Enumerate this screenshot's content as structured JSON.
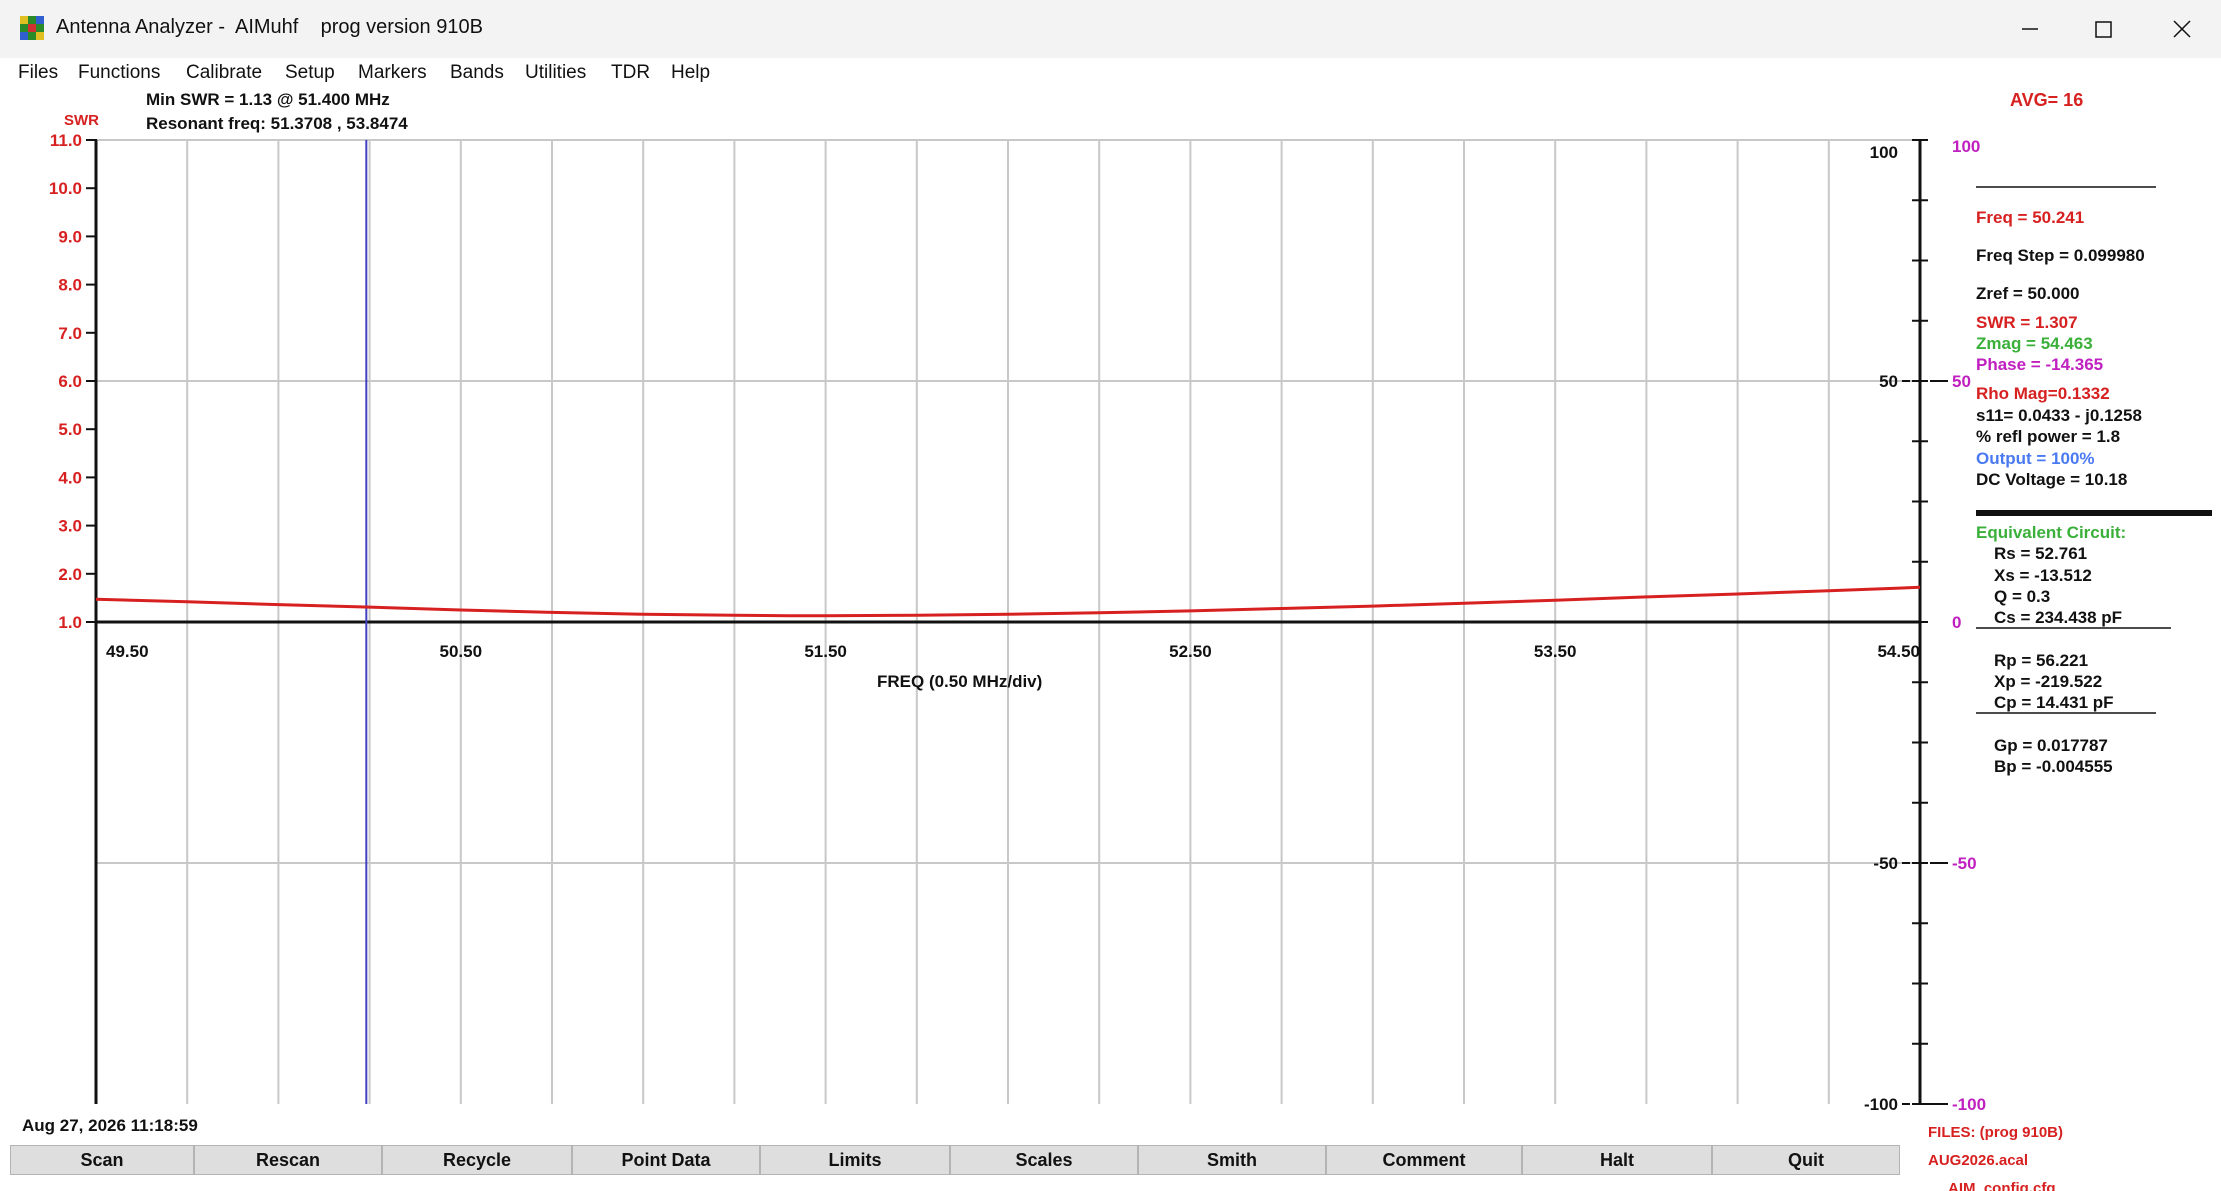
{
  "window": {
    "title": "Antenna Analyzer -  AIMuhf    prog version 910B",
    "icon": "aim-app-icon"
  },
  "menu": [
    "Files",
    "Functions",
    "Calibrate",
    "Setup",
    "Markers",
    "Bands",
    "Utilities",
    "TDR",
    "Help"
  ],
  "header": {
    "min_swr": "Min SWR =   1.13 @  51.400 MHz",
    "resonant": "Resonant freq:  51.3708 , 53.8474",
    "avg": "AVG=  16",
    "swr_axis_label": "SWR"
  },
  "readout": {
    "freq": "Freq = 50.241",
    "freq_step": "Freq Step = 0.099980",
    "zref": "Zref =    50.000",
    "swr": "SWR =    1.307",
    "zmag": "Zmag =    54.463",
    "phase": "Phase =   -14.365",
    "rho_mag": "Rho Mag=0.1332",
    "s11": "s11= 0.0433 - j0.1258",
    "refl_power": "% refl power =   1.8",
    "output": "Output =  100%",
    "dc_voltage": "DC Voltage =  10.18",
    "equiv_title": "Equivalent Circuit:",
    "rs": "Rs =   52.761",
    "xs": "Xs =  -13.512",
    "q": "Q =   0.3",
    "cs": "Cs =  234.438  pF",
    "rp": "Rp =    56.221",
    "xp": "Xp = -219.522",
    "cp": "Cp =   14.431  pF",
    "gp": "Gp =  0.017787",
    "bp": "Bp = -0.004555"
  },
  "status": {
    "timestamp": "Aug 27, 2026  11:18:59",
    "files_label": "FILES:  (prog 910B)",
    "cal_file": "AUG2026.acal",
    "config_file": "AIM_config.cfg"
  },
  "buttons": [
    "Scan",
    "Rescan",
    "Recycle",
    "Point Data",
    "Limits",
    "Scales",
    "Smith",
    "Comment",
    "Halt",
    "Quit"
  ],
  "colors": {
    "swr": "#d72020",
    "zmag": "#3ab03a",
    "phase": "#c020c0",
    "output": "#4a7af2",
    "grid": "#c8c8c8",
    "cursor": "#4040c0"
  },
  "chart_data": {
    "type": "line",
    "xlabel": "FREQ (0.50 MHz/div)",
    "xlim": [
      49.5,
      54.5
    ],
    "x_ticks": [
      "49.50",
      "50.50",
      "51.50",
      "52.50",
      "53.50",
      "54.50"
    ],
    "y_left_label": "SWR",
    "y_left_ticks": [
      "11.0",
      "10.0",
      "9.0",
      "8.0",
      "7.0",
      "6.0",
      "5.0",
      "4.0",
      "3.0",
      "2.0",
      "1.0"
    ],
    "ylim_left": [
      1.0,
      11.0
    ],
    "y_right_inner_ticks": [
      "100",
      "50",
      "-50",
      "-100"
    ],
    "y_right_outer_ticks": [
      "100",
      "50",
      "0",
      "-50",
      "-100"
    ],
    "ylim_right": [
      -100,
      100
    ],
    "cursor_freq": 50.241,
    "grid": true,
    "series": [
      {
        "name": "SWR",
        "x": [
          49.5,
          49.75,
          50.0,
          50.25,
          50.5,
          50.75,
          51.0,
          51.25,
          51.4,
          51.5,
          51.75,
          52.0,
          52.25,
          52.5,
          52.75,
          53.0,
          53.25,
          53.5,
          53.75,
          54.0,
          54.25,
          54.5
        ],
        "values": [
          1.47,
          1.42,
          1.36,
          1.31,
          1.25,
          1.2,
          1.16,
          1.14,
          1.13,
          1.13,
          1.14,
          1.16,
          1.19,
          1.23,
          1.28,
          1.33,
          1.39,
          1.45,
          1.52,
          1.58,
          1.65,
          1.72
        ]
      }
    ]
  }
}
